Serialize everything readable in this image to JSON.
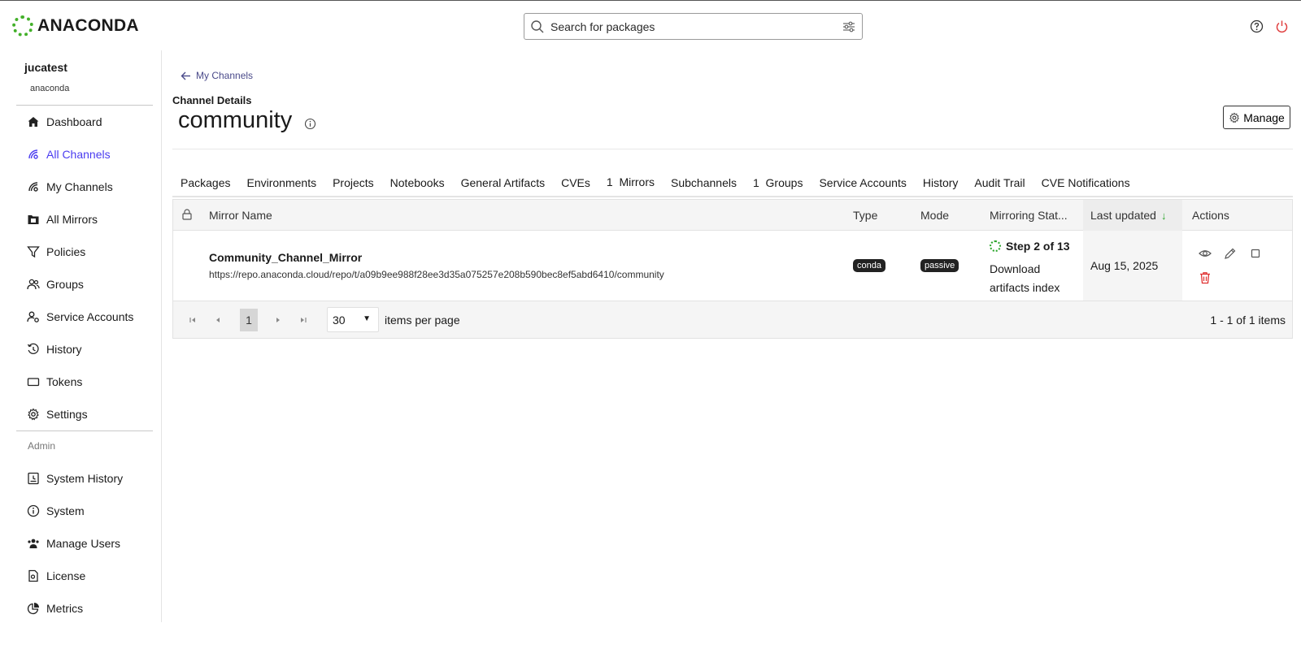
{
  "brand": {
    "name": "ANACONDA",
    "accent": "#43b02a"
  },
  "search": {
    "placeholder": "Search for packages"
  },
  "user": {
    "name": "jucatest",
    "org": "anaconda"
  },
  "sidebar": {
    "items": [
      {
        "label": "Dashboard",
        "icon": "home-icon"
      },
      {
        "label": "All Channels",
        "icon": "channels-icon",
        "active": true
      },
      {
        "label": "My Channels",
        "icon": "channels-icon"
      },
      {
        "label": "All Mirrors",
        "icon": "mirror-icon"
      },
      {
        "label": "Policies",
        "icon": "filter-icon"
      },
      {
        "label": "Groups",
        "icon": "users-icon"
      },
      {
        "label": "Service Accounts",
        "icon": "user-gear-icon"
      },
      {
        "label": "History",
        "icon": "history-icon"
      },
      {
        "label": "Tokens",
        "icon": "token-icon"
      },
      {
        "label": "Settings",
        "icon": "gear-icon"
      }
    ],
    "admin_label": "Admin",
    "admin_items": [
      {
        "label": "System History",
        "icon": "system-history-icon"
      },
      {
        "label": "System",
        "icon": "info-icon"
      },
      {
        "label": "Manage Users",
        "icon": "users-icon"
      },
      {
        "label": "License",
        "icon": "license-icon"
      },
      {
        "label": "Metrics",
        "icon": "pie-chart-icon"
      }
    ]
  },
  "header": {
    "back_label": "My Channels",
    "section_label": "Channel Details",
    "title": "community",
    "manage_label": "Manage"
  },
  "tabs": [
    "Packages",
    "Environments",
    "Projects",
    "Notebooks",
    "General Artifacts",
    "CVEs",
    "1  Mirrors",
    "Subchannels",
    "1  Groups",
    "Service Accounts",
    "History",
    "Audit Trail",
    "CVE Notifications"
  ],
  "active_tab": "1  Mirrors",
  "table": {
    "columns": {
      "name": "Mirror Name",
      "type": "Type",
      "mode": "Mode",
      "status": "Mirroring Stat...",
      "updated": "Last updated",
      "actions": "Actions"
    },
    "sort_arrow": "↓",
    "rows": [
      {
        "name": "Community_Channel_Mirror",
        "url": "https://repo.anaconda.cloud/repo/t/a09b9ee988f28ee3d35a075257e208b590bec8ef5abd6410/community",
        "type": "conda",
        "mode": "passive",
        "status_step": "Step 2 of 13",
        "status_desc": "Download artifacts index",
        "updated": "Aug 15, 2025"
      }
    ]
  },
  "pagination": {
    "current_page": "1",
    "per_page": "30",
    "per_page_label": "items per page",
    "summary": "1 - 1 of 1 items"
  }
}
